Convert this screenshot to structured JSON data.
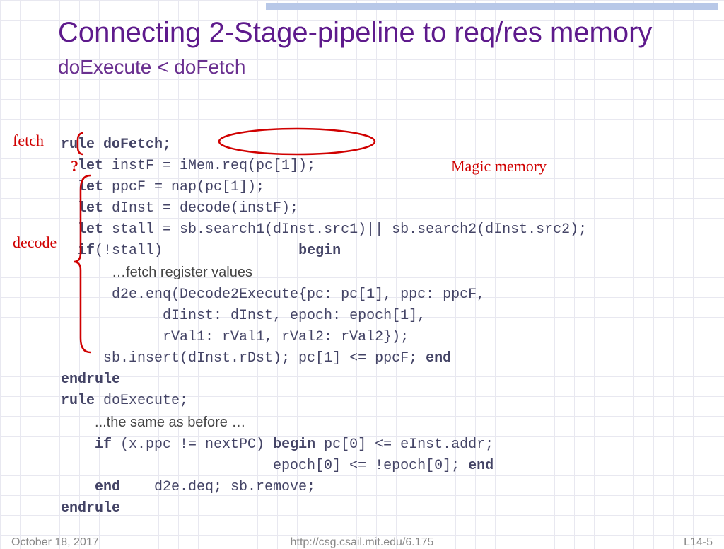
{
  "title_main": "Connecting 2-Stage-pipeline to req/res memory",
  "title_sub": "doExecute < doFetch",
  "anno": {
    "fetch": "fetch",
    "q": "?",
    "decode": "decode",
    "magic": "Magic memory"
  },
  "code": {
    "l1": "rule doFetch;",
    "l2a": "  let",
    "l2b": " instF = iMem.req(pc[1]);",
    "l3a": "  let",
    "l3b": " ppcF = nap(pc[1]);",
    "l4a": "  let",
    "l4b": " dInst = decode(instF);",
    "l5a": "  let",
    "l5b": " stall = sb.search1(dInst.src1)|| sb.search2(dInst.src2);",
    "l6a": "  if",
    "l6b": "(!stall)                ",
    "l6c": "begin",
    "l7": "…fetch register values",
    "l8": "      d2e.enq(Decode2Execute{pc: pc[1], ppc: ppcF,",
    "l9": "            dIinst: dInst, epoch: epoch[1],",
    "l10": "            rVal1: rVal1, rVal2: rVal2});",
    "l11a": "     sb.insert(dInst.rDst); pc[1] <= ppcF; ",
    "l11b": "end",
    "l12": "endrule",
    "l13a": "rule",
    "l13b": " doExecute;",
    "l14": "...the same as before …",
    "l15a": "    if",
    "l15b": " (x.ppc != nextPC) ",
    "l15c": "begin",
    "l15d": " pc[0] <= eInst.addr;",
    "l16a": "                         epoch[0] <= !epoch[0]; ",
    "l16b": "end",
    "l17a": "    end",
    "l17b": "    d2e.deq; sb.remove;",
    "l18": "endrule"
  },
  "footer": {
    "date": "October 18, 2017",
    "url": "http://csg.csail.mit.edu/6.175",
    "page": "L14-5"
  }
}
